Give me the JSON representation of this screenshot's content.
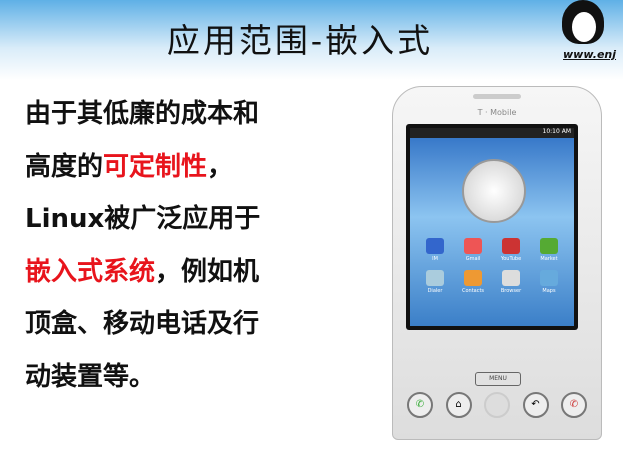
{
  "title": "应用范围-嵌入式",
  "logo": {
    "url": "www.enj"
  },
  "body": {
    "l1": "由于其低廉的成本和",
    "l2a": "高度的",
    "l2b": "可定制性",
    "l2c": "，",
    "l3": "Linux被广泛应用于",
    "l4a": "嵌入式系统",
    "l4b": "，例如机",
    "l5": "顶盒、移动电话及行",
    "l6": "动装置等。"
  },
  "phone": {
    "brand": "T · Mobile",
    "time": "10:10 AM",
    "menu": "MENU",
    "apps": [
      "IM",
      "Gmail",
      "YouTube",
      "Market",
      "Dialer",
      "Contacts",
      "Browser",
      "Maps"
    ]
  },
  "colors": {
    "highlight": "#e8141c"
  }
}
